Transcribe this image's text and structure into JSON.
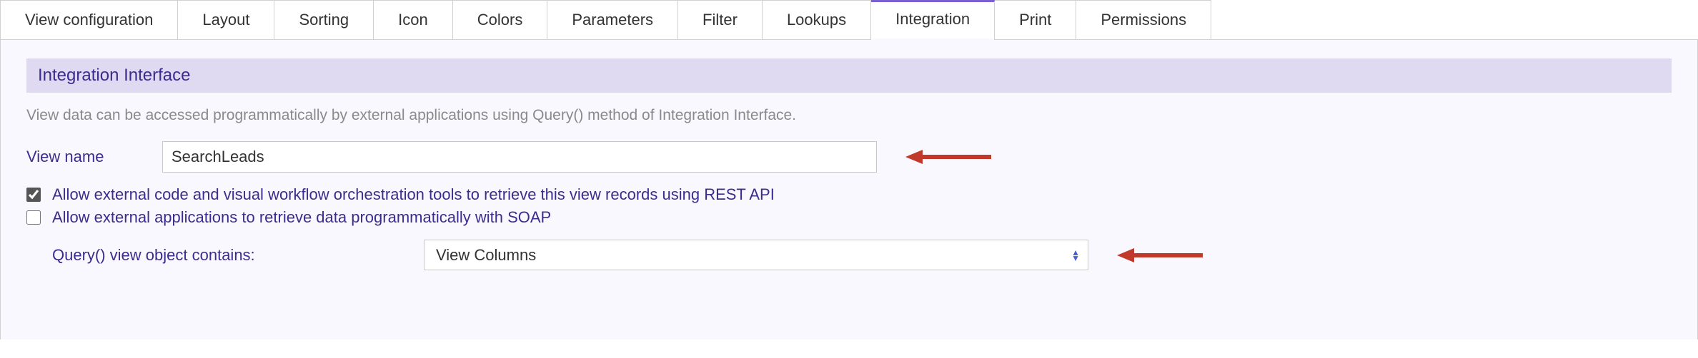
{
  "tabs": [
    {
      "label": "View configuration",
      "active": false
    },
    {
      "label": "Layout",
      "active": false
    },
    {
      "label": "Sorting",
      "active": false
    },
    {
      "label": "Icon",
      "active": false
    },
    {
      "label": "Colors",
      "active": false
    },
    {
      "label": "Parameters",
      "active": false
    },
    {
      "label": "Filter",
      "active": false
    },
    {
      "label": "Lookups",
      "active": false
    },
    {
      "label": "Integration",
      "active": true
    },
    {
      "label": "Print",
      "active": false
    },
    {
      "label": "Permissions",
      "active": false
    }
  ],
  "section": {
    "header": "Integration Interface",
    "description": "View data can be accessed programmatically by external applications using Query() method of Integration Interface."
  },
  "view_name": {
    "label": "View name",
    "value": "SearchLeads"
  },
  "checkboxes": {
    "rest": {
      "label": "Allow external code and visual workflow orchestration tools to retrieve this view records using REST API",
      "checked": true
    },
    "soap": {
      "label": "Allow external applications to retrieve data programmatically with SOAP",
      "checked": false
    }
  },
  "query": {
    "label": "Query() view object contains:",
    "selected": "View Columns"
  },
  "colors": {
    "accent_text": "#3d2c8d",
    "section_bg": "#e0d9f2",
    "panel_bg": "#faf8ff",
    "arrow": "#c0392b"
  }
}
